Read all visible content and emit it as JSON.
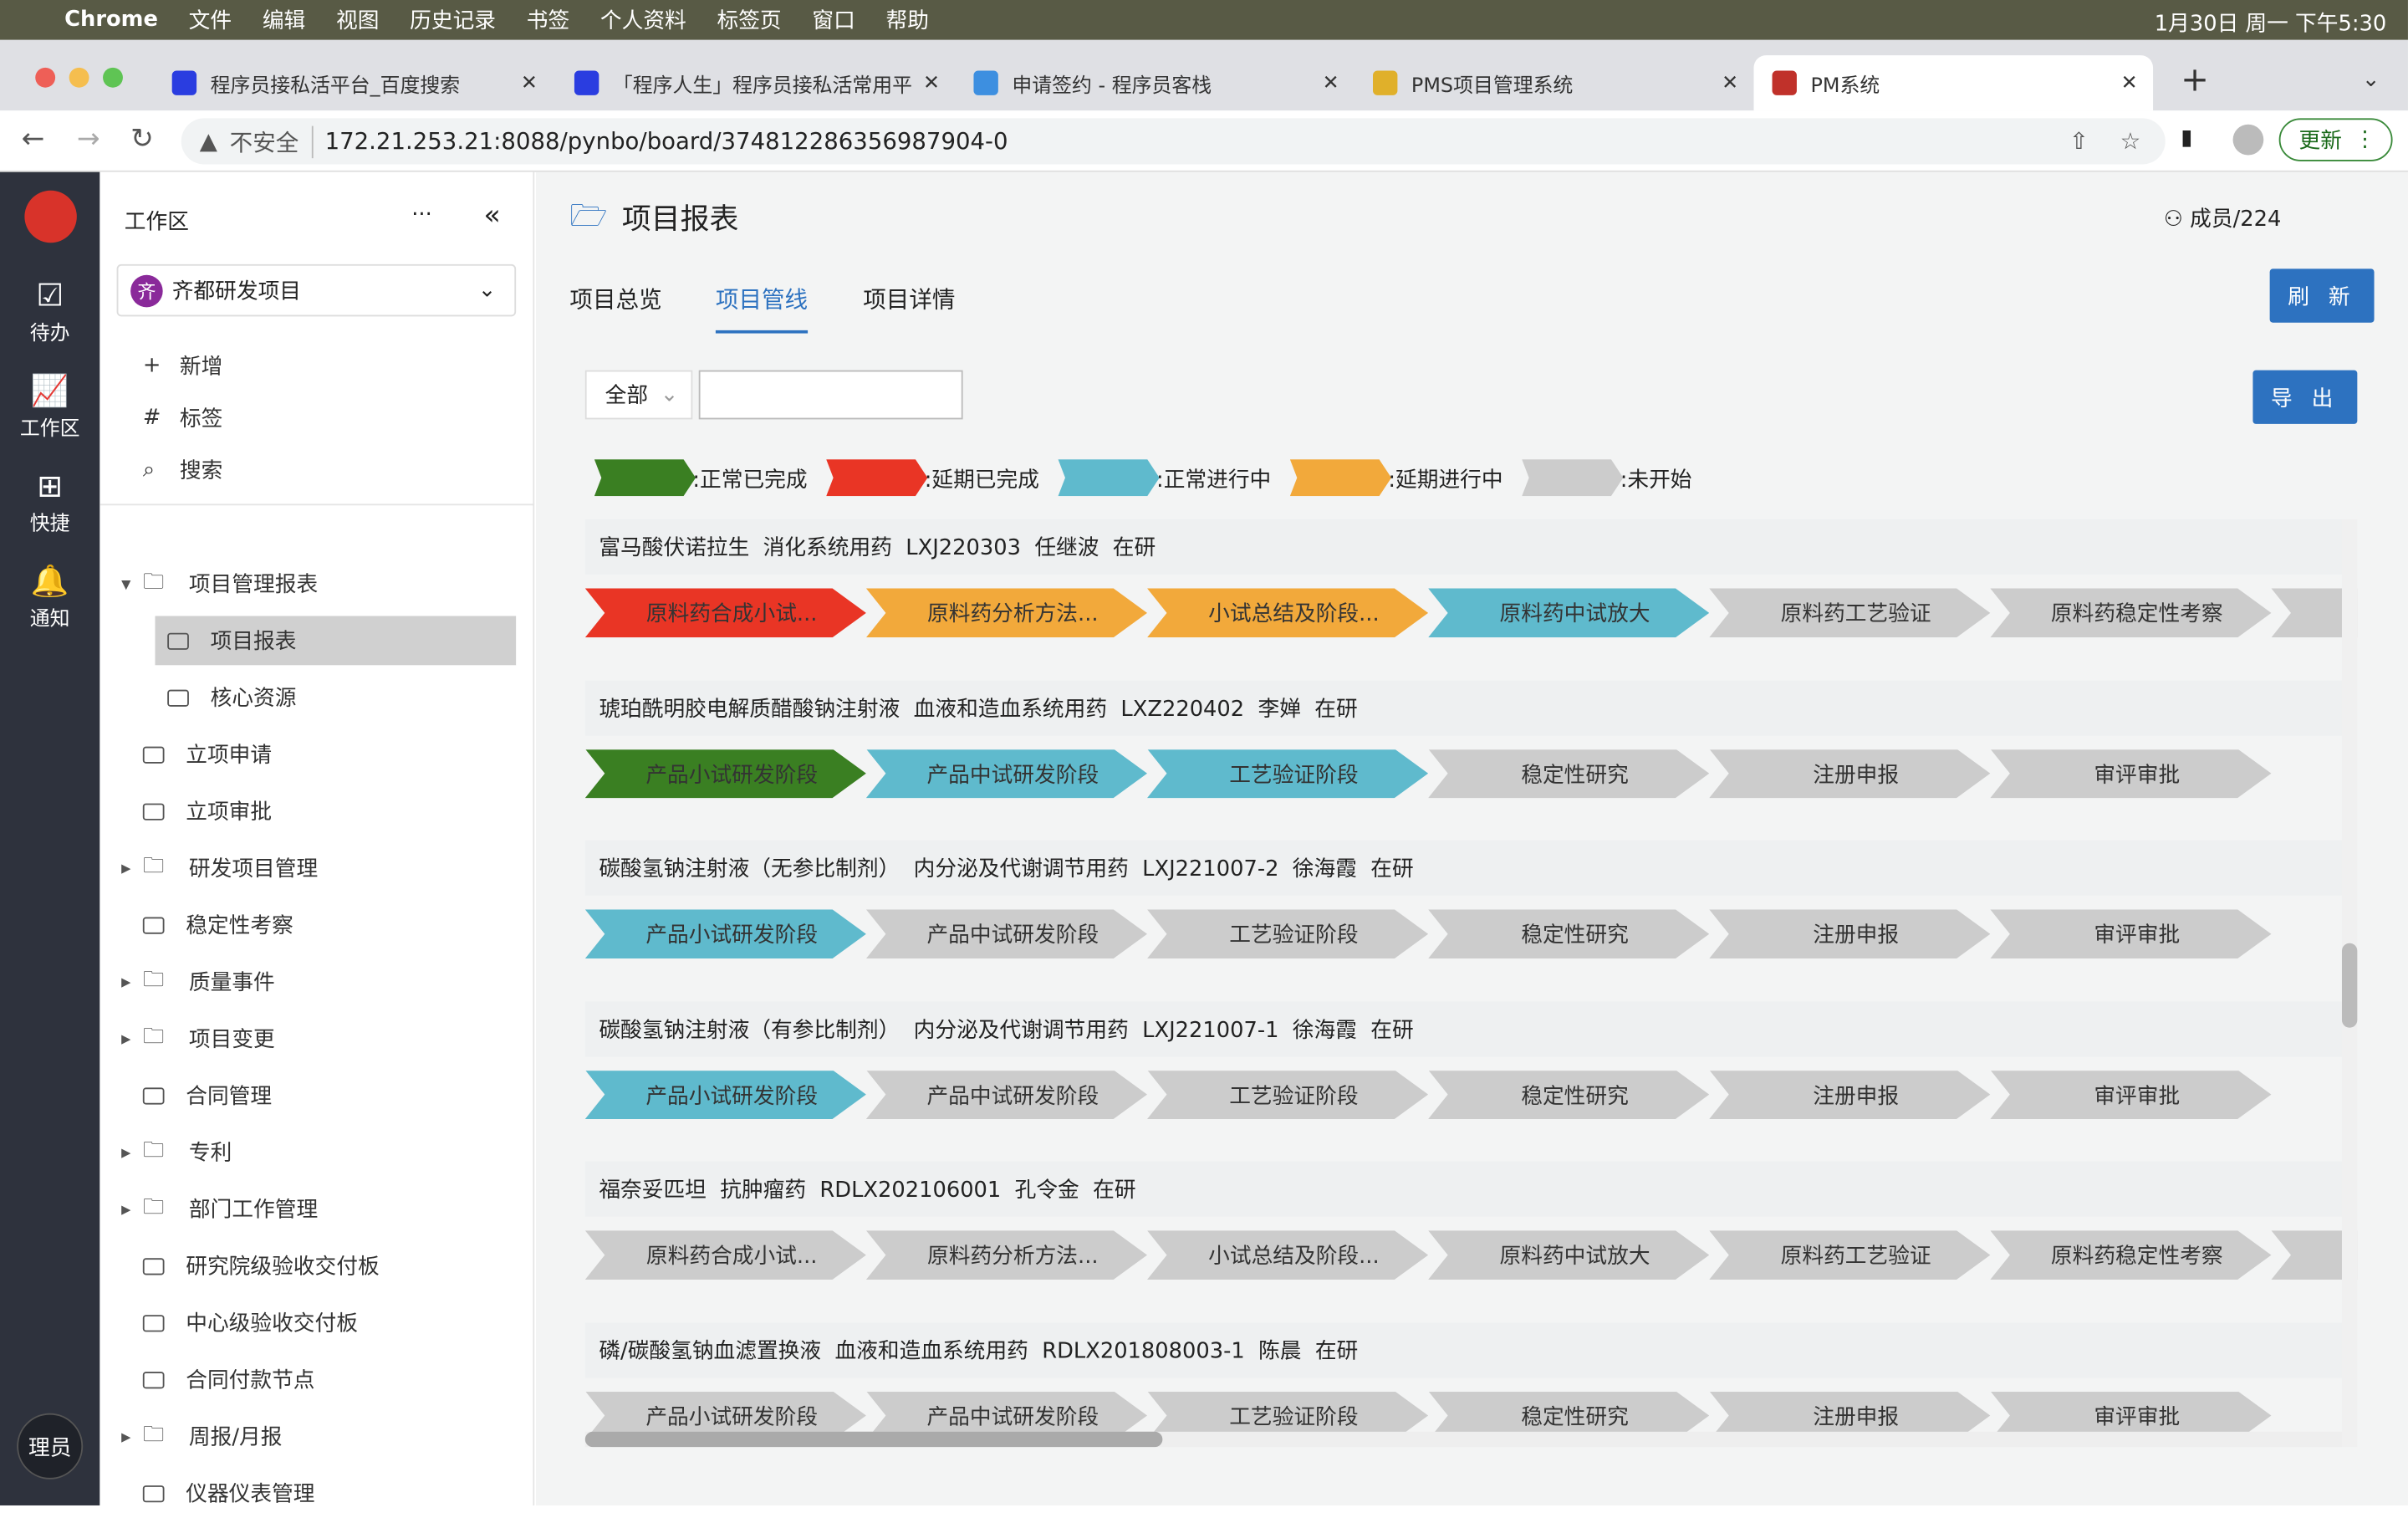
{
  "menubar": {
    "app": "Chrome",
    "items": [
      "文件",
      "编辑",
      "视图",
      "历史记录",
      "书签",
      "个人资料",
      "标签页",
      "窗口",
      "帮助"
    ],
    "clock": "1月30日 周一 下午5:30"
  },
  "tabs": [
    {
      "title": "程序员接私活平台_百度搜索",
      "color": "#2a3de0"
    },
    {
      "title": "「程序人生」程序员接私活常用平",
      "color": "#2a3de0"
    },
    {
      "title": "申请签约 - 程序员客栈",
      "color": "#3d8fe0"
    },
    {
      "title": "PMS项目管理系统",
      "color": "#e0b02a"
    },
    {
      "title": "PM系统",
      "color": "#c0312a"
    }
  ],
  "address": {
    "security": "不安全",
    "url": "172.21.253.21:8088/pynbo/board/374812286356987904-0",
    "update": "更新"
  },
  "rail": [
    {
      "icon": "todo-icon",
      "glyph": "☑",
      "label": "待办"
    },
    {
      "icon": "workspace-icon",
      "glyph": "📈",
      "label": "工作区"
    },
    {
      "icon": "shortcut-icon",
      "glyph": "⊞",
      "label": "快捷"
    },
    {
      "icon": "bell-icon",
      "glyph": "🔔",
      "label": "通知"
    }
  ],
  "user_badge": "理员",
  "sidebar": {
    "title": "工作区",
    "project": "齐都研发项目",
    "project_initial": "齐",
    "actions": [
      {
        "glyph": "+",
        "label": "新增"
      },
      {
        "glyph": "#",
        "label": "标签"
      },
      {
        "glyph": "⌕",
        "label": "搜索"
      }
    ],
    "items": [
      {
        "label": "项目管理报表",
        "type": "folder",
        "expanded": true,
        "level": 0
      },
      {
        "label": "项目报表",
        "type": "page",
        "level": 1,
        "active": true
      },
      {
        "label": "核心资源",
        "type": "page",
        "level": 1
      },
      {
        "label": "立项申请",
        "type": "page",
        "level": 0
      },
      {
        "label": "立项审批",
        "type": "page",
        "level": 0
      },
      {
        "label": "研发项目管理",
        "type": "folder",
        "level": 0
      },
      {
        "label": "稳定性考察",
        "type": "page",
        "level": 0
      },
      {
        "label": "质量事件",
        "type": "folder",
        "level": 0
      },
      {
        "label": "项目变更",
        "type": "folder",
        "level": 0
      },
      {
        "label": "合同管理",
        "type": "page",
        "level": 0
      },
      {
        "label": "专利",
        "type": "folder",
        "level": 0
      },
      {
        "label": "部门工作管理",
        "type": "folder",
        "level": 0
      },
      {
        "label": "研究院级验收交付板",
        "type": "page",
        "level": 0
      },
      {
        "label": "中心级验收交付板",
        "type": "page",
        "level": 0
      },
      {
        "label": "合同付款节点",
        "type": "page",
        "level": 0
      },
      {
        "label": "周报/月报",
        "type": "folder",
        "level": 0
      },
      {
        "label": "仪器仪表管理",
        "type": "page",
        "level": 0
      }
    ]
  },
  "main": {
    "title": "项目报表",
    "members": "成员/224",
    "tabs": [
      "项目总览",
      "项目管线",
      "项目详情"
    ],
    "active_tab": 1,
    "refresh": "刷 新",
    "export": "导 出",
    "filter": {
      "select": "全部",
      "search": ""
    }
  },
  "colors": {
    "done": "#3a7f22",
    "late_done": "#e93525",
    "doing": "#5fbacd",
    "late_doing": "#f2a93b",
    "todo": "#cccccc"
  },
  "legend": [
    {
      "status": "done",
      "label": ":正常已完成"
    },
    {
      "status": "late_done",
      "label": ":延期已完成"
    },
    {
      "status": "doing",
      "label": ":正常进行中"
    },
    {
      "status": "late_doing",
      "label": ":延期进行中"
    },
    {
      "status": "todo",
      "label": ":未开始"
    }
  ],
  "projects": [
    {
      "header": "富马酸伏诺拉生  消化系统用药  LXJ220303  任继波  在研",
      "stages": [
        [
          "原料药合成小试...",
          "late_done"
        ],
        [
          "原料药分析方法...",
          "late_doing"
        ],
        [
          "小试总结及阶段...",
          "late_doing"
        ],
        [
          "原料药中试放大",
          "doing"
        ],
        [
          "原料药工艺验证",
          "todo"
        ],
        [
          "原料药稳定性考察",
          "todo"
        ],
        [
          "",
          "todo"
        ]
      ]
    },
    {
      "header": "琥珀酰明胶电解质醋酸钠注射液  血液和造血系统用药  LXZ220402  李婵  在研",
      "stages": [
        [
          "产品小试研发阶段",
          "done"
        ],
        [
          "产品中试研发阶段",
          "doing"
        ],
        [
          "工艺验证阶段",
          "doing"
        ],
        [
          "稳定性研究",
          "todo"
        ],
        [
          "注册申报",
          "todo"
        ],
        [
          "审评审批",
          "todo"
        ]
      ]
    },
    {
      "header": "碳酸氢钠注射液（无参比制剂）  内分泌及代谢调节用药  LXJ221007-2  徐海霞  在研",
      "stages": [
        [
          "产品小试研发阶段",
          "doing"
        ],
        [
          "产品中试研发阶段",
          "todo"
        ],
        [
          "工艺验证阶段",
          "todo"
        ],
        [
          "稳定性研究",
          "todo"
        ],
        [
          "注册申报",
          "todo"
        ],
        [
          "审评审批",
          "todo"
        ]
      ]
    },
    {
      "header": "碳酸氢钠注射液（有参比制剂）  内分泌及代谢调节用药  LXJ221007-1  徐海霞  在研",
      "stages": [
        [
          "产品小试研发阶段",
          "doing"
        ],
        [
          "产品中试研发阶段",
          "todo"
        ],
        [
          "工艺验证阶段",
          "todo"
        ],
        [
          "稳定性研究",
          "todo"
        ],
        [
          "注册申报",
          "todo"
        ],
        [
          "审评审批",
          "todo"
        ]
      ]
    },
    {
      "header": "福奈妥匹坦  抗肿瘤药  RDLX202106001  孔令金  在研",
      "stages": [
        [
          "原料药合成小试...",
          "todo"
        ],
        [
          "原料药分析方法...",
          "todo"
        ],
        [
          "小试总结及阶段...",
          "todo"
        ],
        [
          "原料药中试放大",
          "todo"
        ],
        [
          "原料药工艺验证",
          "todo"
        ],
        [
          "原料药稳定性考察",
          "todo"
        ],
        [
          "",
          "todo"
        ]
      ]
    },
    {
      "header": "磷/碳酸氢钠血滤置换液  血液和造血系统用药  RDLX201808003-1  陈晨  在研",
      "stages": [
        [
          "产品小试研发阶段",
          "todo"
        ],
        [
          "产品中试研发阶段",
          "todo"
        ],
        [
          "工艺验证阶段",
          "todo"
        ],
        [
          "稳定性研究",
          "todo"
        ],
        [
          "注册申报",
          "todo"
        ],
        [
          "审评审批",
          "todo"
        ]
      ]
    }
  ]
}
